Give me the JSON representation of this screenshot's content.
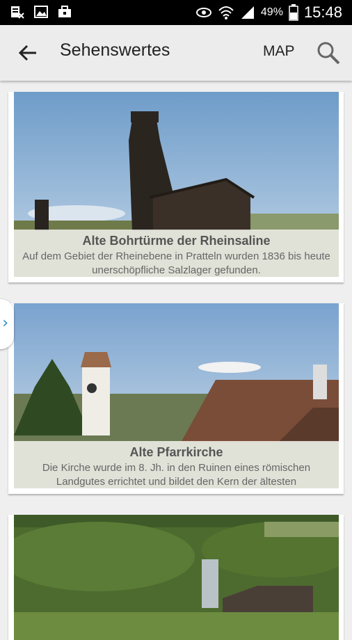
{
  "status": {
    "battery": "49%",
    "time": "15:48"
  },
  "toolbar": {
    "title": "Sehenswertes",
    "map_label": "MAP"
  },
  "cards": [
    {
      "title": "Alte Bohrtürme der Rheinsaline",
      "description": "Auf dem Gebiet der Rheinebene in Pratteln wurden 1836 bis heute unerschöpfliche Salzlager gefunden."
    },
    {
      "title": "Alte Pfarrkirche",
      "description": "Die Kirche wurde im 8. Jh. in den Ruinen eines römischen Landgutes errichtet und bildet den Kern der ältesten"
    },
    {
      "title": "",
      "description": ""
    }
  ],
  "colors": {
    "toolbar_bg": "#ececec",
    "accent": "#2a8ac8"
  }
}
